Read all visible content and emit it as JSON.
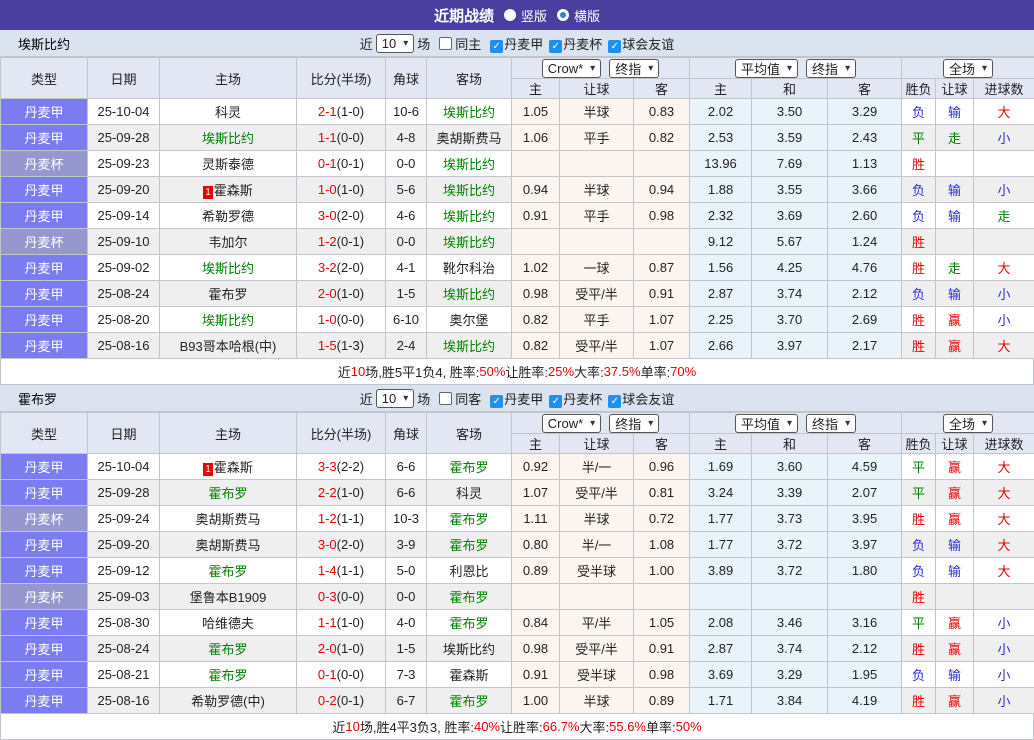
{
  "title_bar": {
    "title": "近期战绩",
    "radio_vertical": "竖版",
    "radio_horizontal": "横版"
  },
  "colors": {
    "accent_purple": "#4a3e9e",
    "league_cell": "#7b7cf2",
    "cup_cell": "#9697ce",
    "crow_col_bg": "#fcf4ee",
    "avg_col_bg": "#e9f3fa",
    "red": "#e80000",
    "green": "#008000",
    "blue": "#2b2bd5"
  },
  "result_colors": {
    "胜": "#e80000",
    "平": "#008000",
    "负": "#2b2bd5",
    "赢": "#e80000",
    "走": "#008000",
    "输": "#2b2bd5",
    "大": "#e80000",
    "小": "#2b2bd5"
  },
  "headers": {
    "type": "类型",
    "date": "日期",
    "home": "主场",
    "score": "比分(半场)",
    "corner": "角球",
    "away": "客场",
    "sub": [
      "主",
      "让球",
      "客",
      "主",
      "和",
      "客",
      "胜负",
      "让球",
      "进球数"
    ]
  },
  "selects": {
    "crow": "Crow*",
    "final1": "终指",
    "avg": "平均值",
    "final2": "终指",
    "full": "全场"
  },
  "sections": [
    {
      "team": "埃斯比约",
      "filter": {
        "near": "近",
        "value": "10",
        "games": "场",
        "same": "同主",
        "checks": [
          "丹麦甲",
          "丹麦杯",
          "球会友谊"
        ]
      },
      "rows": [
        {
          "league": "丹麦甲",
          "cup": false,
          "date": "25-10-04",
          "home": "科灵",
          "hf": false,
          "hb": false,
          "ft": "2-1",
          "ht": "(1-0)",
          "corner": "10-6",
          "away": "埃斯比约",
          "af": true,
          "odds": [
            "1.05",
            "半球",
            "0.83"
          ],
          "avg": [
            "2.02",
            "3.50",
            "3.29"
          ],
          "res": [
            "负",
            "输",
            "大"
          ]
        },
        {
          "league": "丹麦甲",
          "cup": false,
          "date": "25-09-28",
          "home": "埃斯比约",
          "hf": true,
          "hb": false,
          "ft": "1-1",
          "ht": "(0-0)",
          "corner": "4-8",
          "away": "奥胡斯费马",
          "af": false,
          "odds": [
            "1.06",
            "平手",
            "0.82"
          ],
          "avg": [
            "2.53",
            "3.59",
            "2.43"
          ],
          "res": [
            "平",
            "走",
            "小"
          ]
        },
        {
          "league": "丹麦杯",
          "cup": true,
          "date": "25-09-23",
          "home": "灵斯泰德",
          "hf": false,
          "hb": false,
          "ft": "0-1",
          "ht": "(0-1)",
          "corner": "0-0",
          "away": "埃斯比约",
          "af": true,
          "odds": [
            "",
            "",
            ""
          ],
          "avg": [
            "13.96",
            "7.69",
            "1.13"
          ],
          "res": [
            "胜",
            "",
            ""
          ]
        },
        {
          "league": "丹麦甲",
          "cup": false,
          "date": "25-09-20",
          "home": "霍森斯",
          "hf": false,
          "hb": true,
          "ft": "1-0",
          "ht": "(1-0)",
          "corner": "5-6",
          "away": "埃斯比约",
          "af": true,
          "odds": [
            "0.94",
            "半球",
            "0.94"
          ],
          "avg": [
            "1.88",
            "3.55",
            "3.66"
          ],
          "res": [
            "负",
            "输",
            "小"
          ]
        },
        {
          "league": "丹麦甲",
          "cup": false,
          "date": "25-09-14",
          "home": "希勒罗德",
          "hf": false,
          "hb": false,
          "ft": "3-0",
          "ht": "(2-0)",
          "corner": "4-6",
          "away": "埃斯比约",
          "af": true,
          "odds": [
            "0.91",
            "平手",
            "0.98"
          ],
          "avg": [
            "2.32",
            "3.69",
            "2.60"
          ],
          "res": [
            "负",
            "输",
            "走"
          ]
        },
        {
          "league": "丹麦杯",
          "cup": true,
          "date": "25-09-10",
          "home": "韦加尔",
          "hf": false,
          "hb": false,
          "ft": "1-2",
          "ht": "(0-1)",
          "corner": "0-0",
          "away": "埃斯比约",
          "af": true,
          "odds": [
            "",
            "",
            ""
          ],
          "avg": [
            "9.12",
            "5.67",
            "1.24"
          ],
          "res": [
            "胜",
            "",
            ""
          ]
        },
        {
          "league": "丹麦甲",
          "cup": false,
          "date": "25-09-02",
          "home": "埃斯比约",
          "hf": true,
          "hb": false,
          "ft": "3-2",
          "ht": "(2-0)",
          "corner": "4-1",
          "away": "靴尔科治",
          "af": false,
          "odds": [
            "1.02",
            "一球",
            "0.87"
          ],
          "avg": [
            "1.56",
            "4.25",
            "4.76"
          ],
          "res": [
            "胜",
            "走",
            "大"
          ]
        },
        {
          "league": "丹麦甲",
          "cup": false,
          "date": "25-08-24",
          "home": "霍布罗",
          "hf": false,
          "hb": false,
          "ft": "2-0",
          "ht": "(1-0)",
          "corner": "1-5",
          "away": "埃斯比约",
          "af": true,
          "odds": [
            "0.98",
            "受平/半",
            "0.91"
          ],
          "avg": [
            "2.87",
            "3.74",
            "2.12"
          ],
          "res": [
            "负",
            "输",
            "小"
          ]
        },
        {
          "league": "丹麦甲",
          "cup": false,
          "date": "25-08-20",
          "home": "埃斯比约",
          "hf": true,
          "hb": false,
          "ft": "1-0",
          "ht": "(0-0)",
          "corner": "6-10",
          "away": "奥尔堡",
          "af": false,
          "odds": [
            "0.82",
            "平手",
            "1.07"
          ],
          "avg": [
            "2.25",
            "3.70",
            "2.69"
          ],
          "res": [
            "胜",
            "赢",
            "小"
          ]
        },
        {
          "league": "丹麦甲",
          "cup": false,
          "date": "25-08-16",
          "home": "B93哥本哈根(中)",
          "hf": false,
          "hb": false,
          "ft": "1-5",
          "ht": "(1-3)",
          "corner": "2-4",
          "away": "埃斯比约",
          "af": true,
          "odds": [
            "0.82",
            "受平/半",
            "1.07"
          ],
          "avg": [
            "2.66",
            "3.97",
            "2.17"
          ],
          "res": [
            "胜",
            "赢",
            "大"
          ]
        }
      ],
      "summary": [
        {
          "t": "近",
          "c": "k"
        },
        {
          "t": "10",
          "c": "r"
        },
        {
          "t": "场,胜5平1负4, 胜率:",
          "c": "k"
        },
        {
          "t": "50%",
          "c": "r"
        },
        {
          "t": " 让胜率:",
          "c": "k"
        },
        {
          "t": "25%",
          "c": "r"
        },
        {
          "t": " 大率:",
          "c": "k"
        },
        {
          "t": "37.5%",
          "c": "r"
        },
        {
          "t": " 单率:",
          "c": "k"
        },
        {
          "t": "70%",
          "c": "r"
        }
      ]
    },
    {
      "team": "霍布罗",
      "filter": {
        "near": "近",
        "value": "10",
        "games": "场",
        "same": "同客",
        "checks": [
          "丹麦甲",
          "丹麦杯",
          "球会友谊"
        ]
      },
      "rows": [
        {
          "league": "丹麦甲",
          "cup": false,
          "date": "25-10-04",
          "home": "霍森斯",
          "hf": false,
          "hb": true,
          "ft": "3-3",
          "ht": "(2-2)",
          "corner": "6-6",
          "away": "霍布罗",
          "af": true,
          "odds": [
            "0.92",
            "半/一",
            "0.96"
          ],
          "avg": [
            "1.69",
            "3.60",
            "4.59"
          ],
          "res": [
            "平",
            "赢",
            "大"
          ]
        },
        {
          "league": "丹麦甲",
          "cup": false,
          "date": "25-09-28",
          "home": "霍布罗",
          "hf": true,
          "hb": false,
          "ft": "2-2",
          "ht": "(1-0)",
          "corner": "6-6",
          "away": "科灵",
          "af": false,
          "odds": [
            "1.07",
            "受平/半",
            "0.81"
          ],
          "avg": [
            "3.24",
            "3.39",
            "2.07"
          ],
          "res": [
            "平",
            "赢",
            "大"
          ]
        },
        {
          "league": "丹麦杯",
          "cup": true,
          "date": "25-09-24",
          "home": "奥胡斯费马",
          "hf": false,
          "hb": false,
          "ft": "1-2",
          "ht": "(1-1)",
          "corner": "10-3",
          "away": "霍布罗",
          "af": true,
          "odds": [
            "1.11",
            "半球",
            "0.72"
          ],
          "avg": [
            "1.77",
            "3.73",
            "3.95"
          ],
          "res": [
            "胜",
            "赢",
            "大"
          ]
        },
        {
          "league": "丹麦甲",
          "cup": false,
          "date": "25-09-20",
          "home": "奥胡斯费马",
          "hf": false,
          "hb": false,
          "ft": "3-0",
          "ht": "(2-0)",
          "corner": "3-9",
          "away": "霍布罗",
          "af": true,
          "odds": [
            "0.80",
            "半/一",
            "1.08"
          ],
          "avg": [
            "1.77",
            "3.72",
            "3.97"
          ],
          "res": [
            "负",
            "输",
            "大"
          ]
        },
        {
          "league": "丹麦甲",
          "cup": false,
          "date": "25-09-12",
          "home": "霍布罗",
          "hf": true,
          "hb": false,
          "ft": "1-4",
          "ht": "(1-1)",
          "corner": "5-0",
          "away": "利恩比",
          "af": false,
          "odds": [
            "0.89",
            "受半球",
            "1.00"
          ],
          "avg": [
            "3.89",
            "3.72",
            "1.80"
          ],
          "res": [
            "负",
            "输",
            "大"
          ]
        },
        {
          "league": "丹麦杯",
          "cup": true,
          "date": "25-09-03",
          "home": "堡鲁本B1909",
          "hf": false,
          "hb": false,
          "ft": "0-3",
          "ht": "(0-0)",
          "corner": "0-0",
          "away": "霍布罗",
          "af": true,
          "odds": [
            "",
            "",
            ""
          ],
          "avg": [
            "",
            "",
            ""
          ],
          "res": [
            "胜",
            "",
            ""
          ]
        },
        {
          "league": "丹麦甲",
          "cup": false,
          "date": "25-08-30",
          "home": "哈维德夫",
          "hf": false,
          "hb": false,
          "ft": "1-1",
          "ht": "(1-0)",
          "corner": "4-0",
          "away": "霍布罗",
          "af": true,
          "odds": [
            "0.84",
            "平/半",
            "1.05"
          ],
          "avg": [
            "2.08",
            "3.46",
            "3.16"
          ],
          "res": [
            "平",
            "赢",
            "小"
          ]
        },
        {
          "league": "丹麦甲",
          "cup": false,
          "date": "25-08-24",
          "home": "霍布罗",
          "hf": true,
          "hb": false,
          "ft": "2-0",
          "ht": "(1-0)",
          "corner": "1-5",
          "away": "埃斯比约",
          "af": false,
          "odds": [
            "0.98",
            "受平/半",
            "0.91"
          ],
          "avg": [
            "2.87",
            "3.74",
            "2.12"
          ],
          "res": [
            "胜",
            "赢",
            "小"
          ]
        },
        {
          "league": "丹麦甲",
          "cup": false,
          "date": "25-08-21",
          "home": "霍布罗",
          "hf": true,
          "hb": false,
          "ft": "0-1",
          "ht": "(0-0)",
          "corner": "7-3",
          "away": "霍森斯",
          "af": false,
          "odds": [
            "0.91",
            "受半球",
            "0.98"
          ],
          "avg": [
            "3.69",
            "3.29",
            "1.95"
          ],
          "res": [
            "负",
            "输",
            "小"
          ]
        },
        {
          "league": "丹麦甲",
          "cup": false,
          "date": "25-08-16",
          "home": "希勒罗德(中)",
          "hf": false,
          "hb": false,
          "ft": "0-2",
          "ht": "(0-1)",
          "corner": "6-7",
          "away": "霍布罗",
          "af": true,
          "odds": [
            "1.00",
            "半球",
            "0.89"
          ],
          "avg": [
            "1.71",
            "3.84",
            "4.19"
          ],
          "res": [
            "胜",
            "赢",
            "小"
          ]
        }
      ],
      "summary": [
        {
          "t": "近",
          "c": "k"
        },
        {
          "t": "10",
          "c": "r"
        },
        {
          "t": "场,胜4平3负3, 胜率:",
          "c": "k"
        },
        {
          "t": "40%",
          "c": "r"
        },
        {
          "t": " 让胜率:",
          "c": "k"
        },
        {
          "t": "66.7%",
          "c": "r"
        },
        {
          "t": " 大率:",
          "c": "k"
        },
        {
          "t": "55.6%",
          "c": "r"
        },
        {
          "t": " 单率:",
          "c": "k"
        },
        {
          "t": "50%",
          "c": "r"
        }
      ]
    }
  ]
}
